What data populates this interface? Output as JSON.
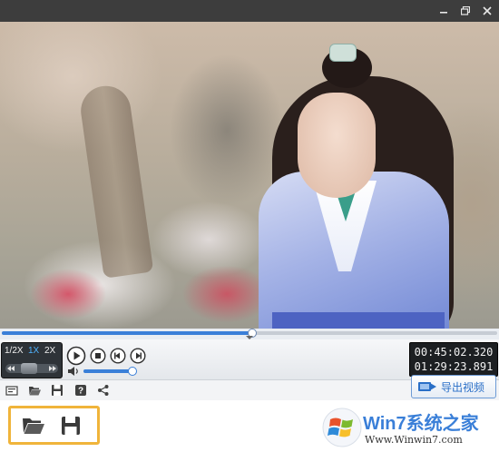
{
  "window": {
    "controls": {
      "minimize_icon": "minimize-icon",
      "restore_icon": "restore-icon",
      "close_icon": "close-icon"
    }
  },
  "playback": {
    "progress_fraction": 0.503,
    "speed_options": [
      "1/2X",
      "1X",
      "2X"
    ],
    "active_speed": "1X",
    "volume_fraction": 0.95,
    "current_time": "00:45:02.320",
    "total_time": "01:29:23.891"
  },
  "toolbar": {
    "tools": [
      "screenshot-icon",
      "open-folder-icon",
      "save-icon",
      "help-icon",
      "share-icon"
    ],
    "export_label": "导出视频"
  },
  "callout": {
    "buttons": [
      "open-folder-icon",
      "save-icon"
    ]
  },
  "watermark": {
    "title": "Win7系统之家",
    "url": "Www.Winwin7.com"
  },
  "colors": {
    "accent": "#3a7fd8",
    "highlight": "#f0b43a",
    "titlebar": "#3d3d3d"
  }
}
